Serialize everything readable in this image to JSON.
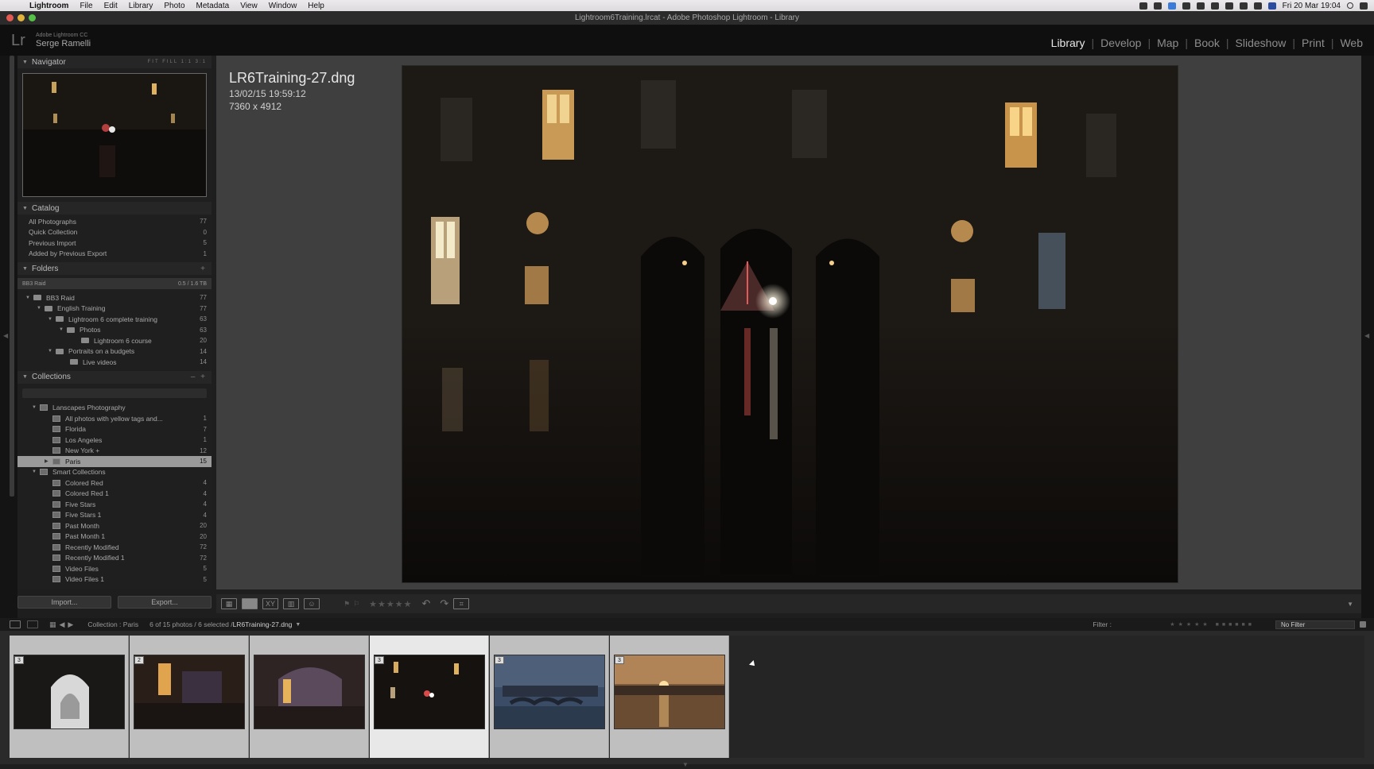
{
  "menubar": {
    "app": "Lightroom",
    "items": [
      "File",
      "Edit",
      "Library",
      "Photo",
      "Metadata",
      "View",
      "Window",
      "Help"
    ],
    "clock": "Fri 20 Mar 19:04"
  },
  "window": {
    "title": "Lightroom6Training.lrcat - Adobe Photoshop Lightroom - Library"
  },
  "identity": {
    "logo": "Lr",
    "subtitle": "Adobe Lightroom CC",
    "name": "Serge Ramelli"
  },
  "modules": [
    {
      "label": "Library",
      "active": true
    },
    {
      "label": "Develop",
      "active": false
    },
    {
      "label": "Map",
      "active": false
    },
    {
      "label": "Book",
      "active": false
    },
    {
      "label": "Slideshow",
      "active": false
    },
    {
      "label": "Print",
      "active": false
    },
    {
      "label": "Web",
      "active": false
    }
  ],
  "navigator": {
    "title": "Navigator",
    "zoom_options": "FIT  FILL  1:1  3:1"
  },
  "catalog": {
    "title": "Catalog",
    "items": [
      {
        "label": "All Photographs",
        "count": "77"
      },
      {
        "label": "Quick Collection",
        "count": "0"
      },
      {
        "label": "Previous Import",
        "count": "5"
      },
      {
        "label": "Added by Previous Export",
        "count": "1"
      }
    ]
  },
  "folders": {
    "title": "Folders",
    "volume": {
      "label": "BB3 Raid",
      "size": "0.5 / 1.6 TB"
    },
    "items": [
      {
        "label": "BB3 Raid",
        "count": "77"
      },
      {
        "label": "English Training",
        "count": "77"
      },
      {
        "label": "Lightroom 6 complete training",
        "count": "63"
      },
      {
        "label": "Photos",
        "count": "63"
      },
      {
        "label": "Lightroom 6 course",
        "count": "20"
      },
      {
        "label": "Portraits on a budgets",
        "count": "14"
      },
      {
        "label": "Live videos",
        "count": "14"
      }
    ]
  },
  "collections": {
    "title": "Collections",
    "items": [
      {
        "label": "Lanscapes Photography",
        "count": ""
      },
      {
        "label": "All photos with yellow tags and...",
        "count": "1"
      },
      {
        "label": "Florida",
        "count": "7"
      },
      {
        "label": "Los Angeles",
        "count": "1"
      },
      {
        "label": "New York +",
        "count": "12"
      },
      {
        "label": "Paris",
        "count": "15"
      },
      {
        "label": "Smart Collections",
        "count": ""
      },
      {
        "label": "Colored Red",
        "count": "4"
      },
      {
        "label": "Colored Red 1",
        "count": "4"
      },
      {
        "label": "Five Stars",
        "count": "4"
      },
      {
        "label": "Five Stars 1",
        "count": "4"
      },
      {
        "label": "Past Month",
        "count": "20"
      },
      {
        "label": "Past Month 1",
        "count": "20"
      },
      {
        "label": "Recently Modified",
        "count": "72"
      },
      {
        "label": "Recently Modified 1",
        "count": "72"
      },
      {
        "label": "Video Files",
        "count": "5"
      },
      {
        "label": "Video Files 1",
        "count": "5"
      }
    ]
  },
  "buttons": {
    "import": "Import...",
    "export": "Export..."
  },
  "photo_info": {
    "filename": "LR6Training-27.dng",
    "datetime": "13/02/15 19:59:12",
    "dimensions": "7360 x 4912"
  },
  "toolbar": {
    "stars": "★★★★★"
  },
  "filmstrip_bar": {
    "source": "Collection : Paris",
    "count": "6 of 15 photos / 6 selected /",
    "filename": "LR6Training-27.dng",
    "filter_label": "Filter :",
    "filter_value": "No Filter"
  },
  "filmstrip": {
    "cells": [
      {
        "badge": "3",
        "selected": false
      },
      {
        "badge": "2",
        "selected": false
      },
      {
        "badge": "",
        "selected": false
      },
      {
        "badge": "3",
        "selected": true
      },
      {
        "badge": "3",
        "selected": false
      },
      {
        "badge": "3",
        "selected": false
      }
    ]
  }
}
